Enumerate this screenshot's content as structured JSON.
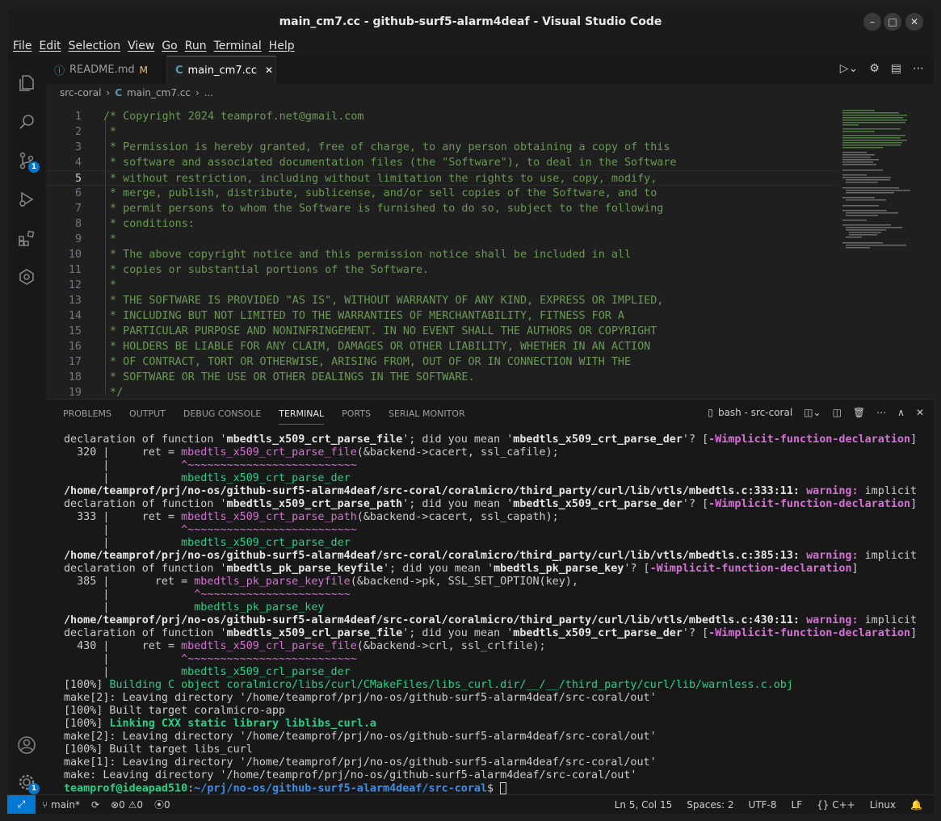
{
  "window": {
    "title": "main_cm7.cc - github-surf5-alarm4deaf - Visual Studio Code"
  },
  "menu": [
    "File",
    "Edit",
    "Selection",
    "View",
    "Go",
    "Run",
    "Terminal",
    "Help"
  ],
  "activity": {
    "scm_badge": "1",
    "settings_badge": "1"
  },
  "tabs": [
    {
      "label": "README.md",
      "status": "M"
    },
    {
      "label": "main_cm7.cc",
      "close": "✕"
    }
  ],
  "breadcrumb": {
    "folder": "src-coral",
    "file": "main_cm7.cc",
    "more": "..."
  },
  "editor": {
    "lines": [
      {
        "n": "1",
        "t": "/* Copyright 2024 teamprof.net@gmail.com"
      },
      {
        "n": "2",
        "t": " *"
      },
      {
        "n": "3",
        "t": " * Permission is hereby granted, free of charge, to any person obtaining a copy of this"
      },
      {
        "n": "4",
        "t": " * software and associated documentation files (the \"Software\"), to deal in the Software"
      },
      {
        "n": "5",
        "t": " * without restriction, including without limitation the rights to use, copy, modify,"
      },
      {
        "n": "6",
        "t": " * merge, publish, distribute, sublicense, and/or sell copies of the Software, and to"
      },
      {
        "n": "7",
        "t": " * permit persons to whom the Software is furnished to do so, subject to the following"
      },
      {
        "n": "8",
        "t": " * conditions:"
      },
      {
        "n": "9",
        "t": " *"
      },
      {
        "n": "10",
        "t": " * The above copyright notice and this permission notice shall be included in all"
      },
      {
        "n": "11",
        "t": " * copies or substantial portions of the Software."
      },
      {
        "n": "12",
        "t": " *"
      },
      {
        "n": "13",
        "t": " * THE SOFTWARE IS PROVIDED \"AS IS\", WITHOUT WARRANTY OF ANY KIND, EXPRESS OR IMPLIED,"
      },
      {
        "n": "14",
        "t": " * INCLUDING BUT NOT LIMITED TO THE WARRANTIES OF MERCHANTABILITY, FITNESS FOR A"
      },
      {
        "n": "15",
        "t": " * PARTICULAR PURPOSE AND NONINFRINGEMENT. IN NO EVENT SHALL THE AUTHORS OR COPYRIGHT"
      },
      {
        "n": "16",
        "t": " * HOLDERS BE LIABLE FOR ANY CLAIM, DAMAGES OR OTHER LIABILITY, WHETHER IN AN ACTION"
      },
      {
        "n": "17",
        "t": " * OF CONTRACT, TORT OR OTHERWISE, ARISING FROM, OUT OF OR IN CONNECTION WITH THE"
      },
      {
        "n": "18",
        "t": " * SOFTWARE OR THE USE OR OTHER DEALINGS IN THE SOFTWARE."
      },
      {
        "n": "19",
        "t": " */"
      }
    ]
  },
  "panel": {
    "tabs": [
      "PROBLEMS",
      "OUTPUT",
      "DEBUG CONSOLE",
      "TERMINAL",
      "PORTS",
      "SERIAL MONITOR"
    ],
    "terminal_name": "bash - src-coral"
  },
  "terminal": {
    "l1a": "declaration of function '",
    "l1b": "mbedtls_x509_crt_parse_file",
    "l1c": "'; did you mean '",
    "l1d": "mbedtls_x509_crt_parse_der",
    "l1e": "'? [",
    "l1f": "-Wimplicit-function-declaration",
    "l1g": "]",
    "l2a": "  320 |     ret = ",
    "l2b": "mbedtls_x509_crt_parse_file",
    "l2c": "(&backend->cacert, ssl_cafile);",
    "l3a": "      |           ",
    "l3b": "^~~~~~~~~~~~~~~~~~~~~~~~~~~",
    "l4a": "      |           ",
    "l4b": "mbedtls_x509_crt_parse_der",
    "l5a": "/home/teamprof/prj/no-os/github-surf5-alarm4deaf/src-coral/coralmicro/third_party/curl/lib/vtls/mbedtls.c:333:11: ",
    "l5b": "warning: ",
    "l5c": "implicit",
    "l6a": "declaration of function '",
    "l6b": "mbedtls_x509_crt_parse_path",
    "l6c": "'; did you mean '",
    "l6d": "mbedtls_x509_crt_parse_der",
    "l6e": "'? [",
    "l6f": "-Wimplicit-function-declaration",
    "l6g": "]",
    "l7a": "  333 |     ret = ",
    "l7b": "mbedtls_x509_crt_parse_path",
    "l7c": "(&backend->cacert, ssl_capath);",
    "l8a": "      |           ",
    "l8b": "^~~~~~~~~~~~~~~~~~~~~~~~~~~",
    "l9a": "      |           ",
    "l9b": "mbedtls_x509_crt_parse_der",
    "l10a": "/home/teamprof/prj/no-os/github-surf5-alarm4deaf/src-coral/coralmicro/third_party/curl/lib/vtls/mbedtls.c:385:13: ",
    "l10b": "warning: ",
    "l10c": "implicit",
    "l11a": "declaration of function '",
    "l11b": "mbedtls_pk_parse_keyfile",
    "l11c": "'; did you mean '",
    "l11d": "mbedtls_pk_parse_key",
    "l11e": "'? [",
    "l11f": "-Wimplicit-function-declaration",
    "l11g": "]",
    "l12a": "  385 |       ret = ",
    "l12b": "mbedtls_pk_parse_keyfile",
    "l12c": "(&backend->pk, SSL_SET_OPTION(key),",
    "l13a": "      |             ",
    "l13b": "^~~~~~~~~~~~~~~~~~~~~~~~",
    "l14a": "      |             ",
    "l14b": "mbedtls_pk_parse_key",
    "l15a": "/home/teamprof/prj/no-os/github-surf5-alarm4deaf/src-coral/coralmicro/third_party/curl/lib/vtls/mbedtls.c:430:11: ",
    "l15b": "warning: ",
    "l15c": "implicit",
    "l16a": "declaration of function '",
    "l16b": "mbedtls_x509_crl_parse_file",
    "l16c": "'; did you mean '",
    "l16d": "mbedtls_x509_crt_parse_der",
    "l16e": "'? [",
    "l16f": "-Wimplicit-function-declaration",
    "l16g": "]",
    "l17a": "  430 |     ret = ",
    "l17b": "mbedtls_x509_crl_parse_file",
    "l17c": "(&backend->crl, ssl_crlfile);",
    "l18a": "      |           ",
    "l18b": "^~~~~~~~~~~~~~~~~~~~~~~~~~~",
    "l19a": "      |           ",
    "l19b": "mbedtls_x509_crl_parse_der",
    "l20a": "[100%] ",
    "l20b": "Building C object coralmicro/libs/curl/CMakeFiles/libs_curl.dir/__/__/third_party/curl/lib/warnless.c.obj",
    "l21": "make[2]: Leaving directory '/home/teamprof/prj/no-os/github-surf5-alarm4deaf/src-coral/out'",
    "l22": "[100%] Built target coralmicro-app",
    "l23a": "[100%] ",
    "l23b": "Linking CXX static library liblibs_curl.a",
    "l24": "make[2]: Leaving directory '/home/teamprof/prj/no-os/github-surf5-alarm4deaf/src-coral/out'",
    "l25": "[100%] Built target libs_curl",
    "l26": "make[1]: Leaving directory '/home/teamprof/prj/no-os/github-surf5-alarm4deaf/src-coral/out'",
    "l27": "make: Leaving directory '/home/teamprof/prj/no-os/github-surf5-alarm4deaf/src-coral/out'",
    "prompt_user": "teamprof@ideapad510",
    "prompt_colon": ":",
    "prompt_path": "~/prj/no-os/github-surf5-alarm4deaf/src-coral",
    "prompt_dollar": "$ "
  },
  "statusbar": {
    "branch": "main*",
    "errors": "0",
    "warnings": "0",
    "ports": "0",
    "position": "Ln 5, Col 15",
    "spaces": "Spaces: 2",
    "encoding": "UTF-8",
    "eol": "LF",
    "language": "C++",
    "os": "Linux"
  },
  "colors": {
    "accent": "#0078d4",
    "comment": "#6a9955",
    "magenta": "#d670d6",
    "green": "#23d18b"
  }
}
